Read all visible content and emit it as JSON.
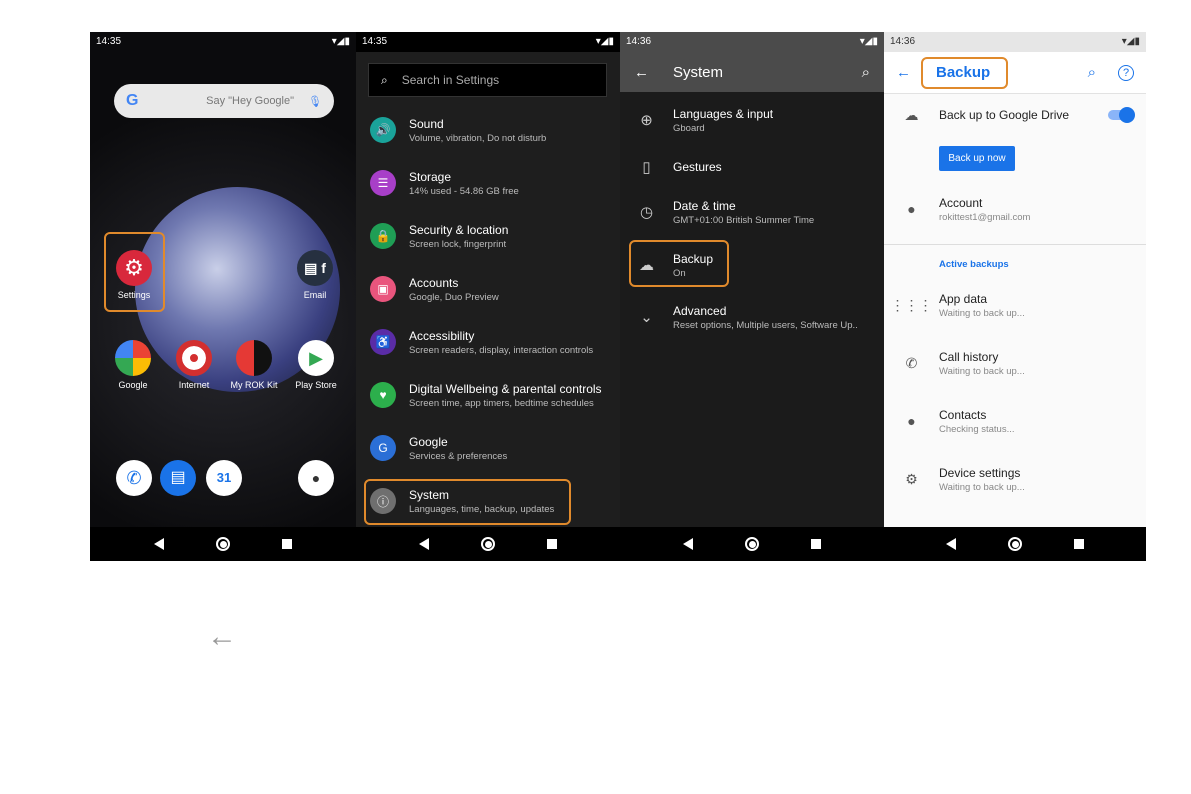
{
  "panel1": {
    "time": "14:35",
    "search_placeholder": "Say \"Hey Google\"",
    "apps": [
      {
        "label": "Settings"
      },
      {
        "label": "Email"
      },
      {
        "label": "Google"
      },
      {
        "label": "Internet"
      },
      {
        "label": "My ROK Kit"
      },
      {
        "label": "Play Store"
      }
    ],
    "dock_calendar": "31"
  },
  "panel2": {
    "time": "14:35",
    "search_placeholder": "Search in Settings",
    "items": [
      {
        "title": "Sound",
        "subtitle": "Volume, vibration, Do not disturb",
        "color": "#1aa39a"
      },
      {
        "title": "Storage",
        "subtitle": "14% used - 54.86 GB free",
        "color": "#a83fc8"
      },
      {
        "title": "Security & location",
        "subtitle": "Screen lock, fingerprint",
        "color": "#1f9e55"
      },
      {
        "title": "Accounts",
        "subtitle": "Google, Duo Preview",
        "color": "#e9557d"
      },
      {
        "title": "Accessibility",
        "subtitle": "Screen readers, display, interaction controls",
        "color": "#5a2ca6"
      },
      {
        "title": "Digital Wellbeing & parental controls",
        "subtitle": "Screen time, app timers, bedtime schedules",
        "color": "#2caf4c"
      },
      {
        "title": "Google",
        "subtitle": "Services & preferences",
        "color": "#2b6fd6"
      },
      {
        "title": "System",
        "subtitle": "Languages, time, backup, updates",
        "color": "#6f6f6f"
      }
    ]
  },
  "panel3": {
    "time": "14:36",
    "title": "System",
    "items": [
      {
        "title": "Languages & input",
        "subtitle": "Gboard",
        "icon": "globe-icon"
      },
      {
        "title": "Gestures",
        "subtitle": "",
        "icon": "gestures-icon"
      },
      {
        "title": "Date & time",
        "subtitle": "GMT+01:00 British Summer Time",
        "icon": "clock-icon"
      },
      {
        "title": "Backup",
        "subtitle": "On",
        "icon": "cloud-icon"
      },
      {
        "title": "Advanced",
        "subtitle": "Reset options, Multiple users, Software Up..",
        "icon": "chevron-down-icon"
      }
    ]
  },
  "panel4": {
    "time": "14:36",
    "title": "Backup",
    "drive_label": "Back up to Google Drive",
    "drive_on": true,
    "backup_now": "Back up now",
    "account_title": "Account",
    "account_email": "rokittest1@gmail.com",
    "section": "Active backups",
    "items": [
      {
        "title": "App data",
        "subtitle": "Waiting to back up..."
      },
      {
        "title": "Call history",
        "subtitle": "Waiting to back up..."
      },
      {
        "title": "Contacts",
        "subtitle": "Checking status..."
      },
      {
        "title": "Device settings",
        "subtitle": "Waiting to back up..."
      }
    ]
  },
  "accent": "#1a73e8",
  "highlight": "#e08a2c"
}
